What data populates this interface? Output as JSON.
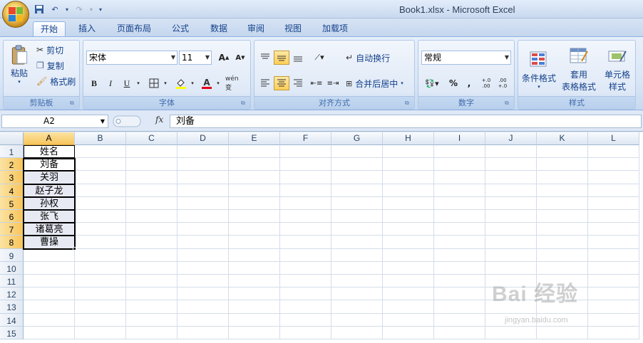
{
  "window": {
    "title": "Book1.xlsx - Microsoft Excel"
  },
  "tabs": [
    "开始",
    "插入",
    "页面布局",
    "公式",
    "数据",
    "审阅",
    "视图",
    "加载项"
  ],
  "ribbon": {
    "clipboard": {
      "label": "剪贴板",
      "paste": "粘贴",
      "cut": "剪切",
      "copy": "复制",
      "format_painter": "格式刷"
    },
    "font": {
      "label": "字体",
      "font_name": "宋体",
      "font_size": "11",
      "bold": "B",
      "italic": "I",
      "underline": "U",
      "phonetic": "wén 变"
    },
    "alignment": {
      "label": "对齐方式",
      "wrap_text": "自动换行",
      "merge_center": "合并后居中"
    },
    "number": {
      "label": "数字",
      "format": "常规",
      "percent": "%",
      "comma": ",",
      "inc_decimal": "+.0 .00",
      "dec_decimal": ".00 +.0"
    },
    "styles": {
      "label": "样式",
      "conditional": "条件格式",
      "table_line1": "套用",
      "table_line2": "表格格式",
      "cell_line1": "单元格",
      "cell_line2": "样式"
    }
  },
  "formula_bar": {
    "name_box": "A2",
    "fx": "fx",
    "content": "刘备"
  },
  "columns": [
    "A",
    "B",
    "C",
    "D",
    "E",
    "F",
    "G",
    "H",
    "I",
    "J",
    "K",
    "L"
  ],
  "rows": [
    "1",
    "2",
    "3",
    "4",
    "5",
    "6",
    "7",
    "8",
    "9",
    "10",
    "11",
    "12",
    "13",
    "14",
    "15"
  ],
  "cells": {
    "A1": "姓名",
    "A2": "刘备",
    "A3": "关羽",
    "A4": "赵子龙",
    "A5": "孙权",
    "A6": "张飞",
    "A7": "诸葛亮",
    "A8": "曹操"
  },
  "watermark": {
    "brand": "Bai 经验",
    "url": "jingyan.baidu.com"
  }
}
